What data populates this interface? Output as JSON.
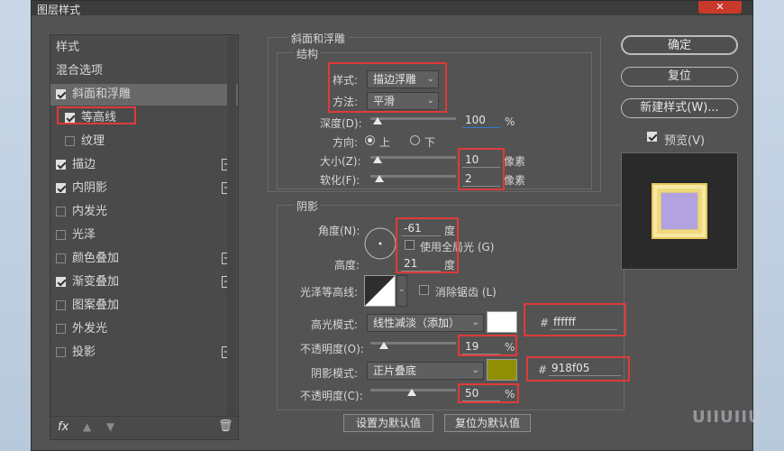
{
  "window": {
    "title": "图层样式",
    "close_label": "✕"
  },
  "left_panel": {
    "items": [
      {
        "label": "样式",
        "checkbox": "none",
        "plus": false,
        "selected": false
      },
      {
        "label": "混合选项",
        "checkbox": "none",
        "plus": false,
        "selected": false
      },
      {
        "label": "斜面和浮雕",
        "checkbox": "on",
        "plus": false,
        "selected": true
      },
      {
        "label": "等高线",
        "checkbox": "on",
        "plus": false,
        "selected": false
      },
      {
        "label": "纹理",
        "checkbox": "off",
        "plus": false,
        "selected": false
      },
      {
        "label": "描边",
        "checkbox": "on",
        "plus": true,
        "selected": false
      },
      {
        "label": "内阴影",
        "checkbox": "on",
        "plus": true,
        "selected": false
      },
      {
        "label": "内发光",
        "checkbox": "off",
        "plus": false,
        "selected": false
      },
      {
        "label": "光泽",
        "checkbox": "off",
        "plus": false,
        "selected": false
      },
      {
        "label": "颜色叠加",
        "checkbox": "off",
        "plus": true,
        "selected": false
      },
      {
        "label": "渐变叠加",
        "checkbox": "on",
        "plus": true,
        "selected": false
      },
      {
        "label": "图案叠加",
        "checkbox": "off",
        "plus": false,
        "selected": false
      },
      {
        "label": "外发光",
        "checkbox": "off",
        "plus": false,
        "selected": false
      },
      {
        "label": "投影",
        "checkbox": "off",
        "plus": true,
        "selected": false
      }
    ],
    "footer": {
      "fx": "fx"
    }
  },
  "bevel": {
    "group_title": "斜面和浮雕",
    "structure_title": "结构",
    "style_label": "样式:",
    "style_value": "描边浮雕",
    "method_label": "方法:",
    "method_value": "平滑",
    "depth_label": "深度(D):",
    "depth_value": "100",
    "depth_unit": "%",
    "direction_label": "方向:",
    "direction_up": "上",
    "direction_down": "下",
    "size_label": "大小(Z):",
    "size_value": "10",
    "size_unit": "像素",
    "soften_label": "软化(F):",
    "soften_value": "2",
    "soften_unit": "像素"
  },
  "shading": {
    "title": "阴影",
    "angle_label": "角度(N):",
    "angle_value": "-61",
    "angle_unit": "度",
    "global_light_label": "使用全局光 (G)",
    "altitude_label": "高度:",
    "altitude_value": "21",
    "altitude_unit": "度",
    "gloss_label": "光泽等高线:",
    "antialias_label": "消除锯齿 (L)",
    "highlight_mode_label": "高光模式:",
    "highlight_mode_value": "线性减淡（添加）",
    "highlight_color_hex": "ffffff",
    "highlight_color": "#ffffff",
    "highlight_opacity_label": "不透明度(O):",
    "highlight_opacity_value": "19",
    "highlight_opacity_unit": "%",
    "shadow_mode_label": "阴影模式:",
    "shadow_mode_value": "正片叠底",
    "shadow_color_hex": "918f05",
    "shadow_color": "#918f05",
    "shadow_opacity_label": "不透明度(C):",
    "shadow_opacity_value": "50",
    "shadow_opacity_unit": "%",
    "hash": "#"
  },
  "bottom_buttons": {
    "set_default": "设置为默认值",
    "reset_default": "复位为默认值"
  },
  "right_panel": {
    "ok": "确定",
    "reset": "复位",
    "new_style": "新建样式(W)...",
    "preview_label": "预览(V)"
  },
  "watermark": "UIIUIIU"
}
